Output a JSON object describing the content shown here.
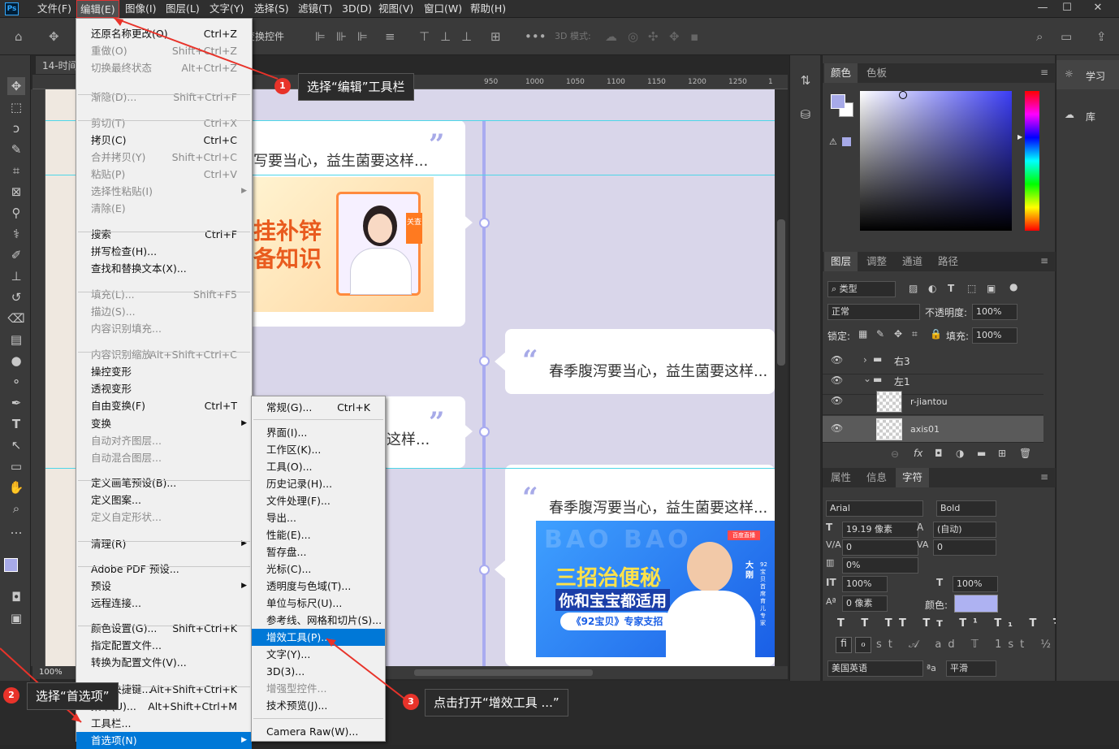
{
  "app": {
    "logo": "Ps"
  },
  "menubar": {
    "items": [
      "文件(F)",
      "编辑(E)",
      "图像(I)",
      "图层(L)",
      "文字(Y)",
      "选择(S)",
      "滤镜(T)",
      "3D(D)",
      "视图(V)",
      "窗口(W)",
      "帮助(H)"
    ]
  },
  "window_controls": {
    "minimize": "—",
    "restore": "☐",
    "close": "✕"
  },
  "optbar": {
    "transform_label": "变换控件",
    "mode3d": "3D 模式:"
  },
  "doc_tab": "14-时间",
  "ruler": {
    "ticks": [
      "950",
      "1000",
      "1050",
      "1100",
      "1150",
      "1200",
      "1250",
      "1"
    ]
  },
  "status": {
    "zoom": "100%"
  },
  "canvas": {
    "card_text_left": "写要当心，益生菌要这样...",
    "card_text_right": "春季腹泻要当心，益生菌要这样...",
    "card_text_mid": "这样...",
    "quote_close": "”",
    "quote_open": "“",
    "banner1": {
      "line1": "挂补锌",
      "line2": "备知识",
      "tag": "关查"
    },
    "banner2": {
      "bg_text": "BAO BAO",
      "line1": "三招治便秘",
      "line2": "你和宝宝都适用",
      "pill": "《92宝贝》专家支招",
      "badge": "百度直播",
      "name": "大刚",
      "role": "92宝贝 首席育儿专家"
    }
  },
  "edit_menu": {
    "items": [
      {
        "label": "还原名称更改(O)",
        "shortcut": "Ctrl+Z",
        "disabled": false
      },
      {
        "label": "重做(O)",
        "shortcut": "Shift+Ctrl+Z",
        "disabled": true
      },
      {
        "label": "切换最终状态",
        "shortcut": "Alt+Ctrl+Z",
        "disabled": true
      },
      {
        "label": "渐隐(D)...",
        "shortcut": "Shift+Ctrl+F",
        "disabled": true
      },
      {
        "label": "剪切(T)",
        "shortcut": "Ctrl+X",
        "disabled": true
      },
      {
        "label": "拷贝(C)",
        "shortcut": "Ctrl+C",
        "disabled": false
      },
      {
        "label": "合并拷贝(Y)",
        "shortcut": "Shift+Ctrl+C",
        "disabled": true
      },
      {
        "label": "粘贴(P)",
        "shortcut": "Ctrl+V",
        "disabled": true
      },
      {
        "label": "选择性粘贴(I)",
        "shortcut": "",
        "disabled": true
      },
      {
        "label": "清除(E)",
        "shortcut": "",
        "disabled": true
      },
      {
        "label": "搜索",
        "shortcut": "Ctrl+F",
        "disabled": false
      },
      {
        "label": "拼写检查(H)...",
        "shortcut": "",
        "disabled": false
      },
      {
        "label": "查找和替换文本(X)...",
        "shortcut": "",
        "disabled": false
      },
      {
        "label": "填充(L)...",
        "shortcut": "Shift+F5",
        "disabled": true
      },
      {
        "label": "描边(S)...",
        "shortcut": "",
        "disabled": true
      },
      {
        "label": "内容识别填充...",
        "shortcut": "",
        "disabled": true
      },
      {
        "label": "内容识别缩放",
        "shortcut": "Alt+Shift+Ctrl+C",
        "disabled": true
      },
      {
        "label": "操控变形",
        "shortcut": "",
        "disabled": false
      },
      {
        "label": "透视变形",
        "shortcut": "",
        "disabled": false
      },
      {
        "label": "自由变换(F)",
        "shortcut": "Ctrl+T",
        "disabled": false
      },
      {
        "label": "变换",
        "shortcut": "",
        "disabled": false
      },
      {
        "label": "自动对齐图层...",
        "shortcut": "",
        "disabled": true
      },
      {
        "label": "自动混合图层...",
        "shortcut": "",
        "disabled": true
      },
      {
        "label": "定义画笔预设(B)...",
        "shortcut": "",
        "disabled": false
      },
      {
        "label": "定义图案...",
        "shortcut": "",
        "disabled": false
      },
      {
        "label": "定义自定形状...",
        "shortcut": "",
        "disabled": true
      },
      {
        "label": "清理(R)",
        "shortcut": "",
        "disabled": false
      },
      {
        "label": "Adobe PDF 预设...",
        "shortcut": "",
        "disabled": false
      },
      {
        "label": "预设",
        "shortcut": "",
        "disabled": false
      },
      {
        "label": "远程连接...",
        "shortcut": "",
        "disabled": false
      },
      {
        "label": "颜色设置(G)...",
        "shortcut": "Shift+Ctrl+K",
        "disabled": false
      },
      {
        "label": "指定配置文件...",
        "shortcut": "",
        "disabled": false
      },
      {
        "label": "转换为配置文件(V)...",
        "shortcut": "",
        "disabled": false
      },
      {
        "label": "键盘快捷键...",
        "shortcut": "Alt+Shift+Ctrl+K",
        "disabled": false
      },
      {
        "label": "菜单(U)...",
        "shortcut": "Alt+Shift+Ctrl+M",
        "disabled": false
      },
      {
        "label": "工具栏...",
        "shortcut": "",
        "disabled": false
      },
      {
        "label": "首选项(N)",
        "shortcut": "",
        "disabled": false
      }
    ]
  },
  "prefs_menu": {
    "items": [
      {
        "label": "常规(G)...",
        "shortcut": "Ctrl+K"
      },
      {
        "label": "界面(I)...",
        "shortcut": ""
      },
      {
        "label": "工作区(K)...",
        "shortcut": ""
      },
      {
        "label": "工具(O)...",
        "shortcut": ""
      },
      {
        "label": "历史记录(H)...",
        "shortcut": ""
      },
      {
        "label": "文件处理(F)...",
        "shortcut": ""
      },
      {
        "label": "导出...",
        "shortcut": ""
      },
      {
        "label": "性能(E)...",
        "shortcut": ""
      },
      {
        "label": "暂存盘...",
        "shortcut": ""
      },
      {
        "label": "光标(C)...",
        "shortcut": ""
      },
      {
        "label": "透明度与色域(T)...",
        "shortcut": ""
      },
      {
        "label": "单位与标尺(U)...",
        "shortcut": ""
      },
      {
        "label": "参考线、网格和切片(S)...",
        "shortcut": ""
      },
      {
        "label": "增效工具(P)...",
        "shortcut": ""
      },
      {
        "label": "文字(Y)...",
        "shortcut": ""
      },
      {
        "label": "3D(3)...",
        "shortcut": ""
      },
      {
        "label": "增强型控件...",
        "shortcut": ""
      },
      {
        "label": "技术预览(J)...",
        "shortcut": ""
      },
      {
        "label": "Camera Raw(W)...",
        "shortcut": ""
      }
    ]
  },
  "callouts": [
    {
      "num": "1",
      "text": "选择“编辑”工具栏"
    },
    {
      "num": "2",
      "text": "选择“首选项”"
    },
    {
      "num": "3",
      "text": "点击打开“增效工具 ...”"
    }
  ],
  "panels": {
    "color_tabs": [
      "颜色",
      "色板"
    ],
    "learn": "学习",
    "library": "库",
    "layers_tabs": [
      "图层",
      "调整",
      "通道",
      "路径"
    ],
    "filter_kind": "类型",
    "blend_mode": "正常",
    "opacity_label": "不透明度:",
    "opacity": "100%",
    "lock_label": "锁定:",
    "fill_label": "填充:",
    "fill": "100%",
    "layers": [
      {
        "name": "右3",
        "type": "group",
        "expanded": false
      },
      {
        "name": "左1",
        "type": "group",
        "expanded": true
      },
      {
        "name": "r-jiantou",
        "type": "smart"
      },
      {
        "name": "axis01",
        "type": "smart",
        "selected": true
      }
    ],
    "char_tabs": [
      "属性",
      "信息",
      "字符"
    ],
    "font_family": "Arial",
    "font_style": "Bold",
    "font_size": "19.19 像素",
    "leading": "(自动)",
    "kerning": "0",
    "tracking": "0",
    "scale_pct": "0%",
    "vscale": "100%",
    "hscale": "100%",
    "baseline": "0 像素",
    "color_label": "颜色:",
    "text_color": "#aeb2f2",
    "language": "美国英语",
    "aa_label": "ªa",
    "aa_mode": "平滑",
    "fg_color": "#a7aae8"
  }
}
